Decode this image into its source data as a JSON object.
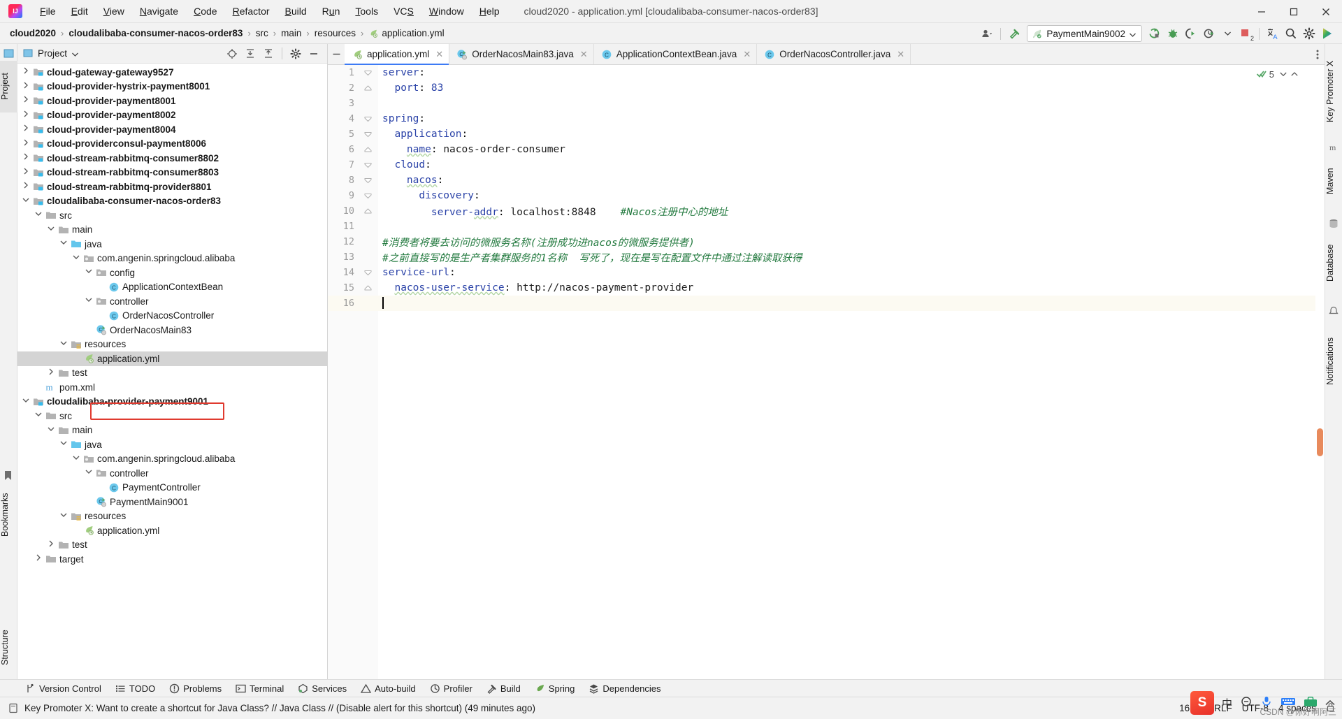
{
  "window": {
    "title": "cloud2020 - application.yml [cloudalibaba-consumer-nacos-order83]",
    "logo_text": "IJ",
    "minimize_label": "Minimize",
    "maximize_label": "Maximize",
    "close_label": "Close"
  },
  "menubar": {
    "items": [
      {
        "label": "File",
        "mnemonic": "F"
      },
      {
        "label": "Edit",
        "mnemonic": "E"
      },
      {
        "label": "View",
        "mnemonic": "V"
      },
      {
        "label": "Navigate",
        "mnemonic": "N"
      },
      {
        "label": "Code",
        "mnemonic": "C"
      },
      {
        "label": "Refactor",
        "mnemonic": "R"
      },
      {
        "label": "Build",
        "mnemonic": "B"
      },
      {
        "label": "Run",
        "mnemonic": "u"
      },
      {
        "label": "Tools",
        "mnemonic": "T"
      },
      {
        "label": "VCS",
        "mnemonic": "S"
      },
      {
        "label": "Window",
        "mnemonic": "W"
      },
      {
        "label": "Help",
        "mnemonic": "H"
      }
    ]
  },
  "breadcrumb": {
    "items": [
      {
        "label": "cloud2020",
        "bold": true,
        "icon": null
      },
      {
        "label": "cloudalibaba-consumer-nacos-order83",
        "bold": true,
        "icon": null
      },
      {
        "label": "src",
        "bold": false,
        "icon": null
      },
      {
        "label": "main",
        "bold": false,
        "icon": null
      },
      {
        "label": "resources",
        "bold": false,
        "icon": null
      },
      {
        "label": "application.yml",
        "bold": false,
        "icon": "yml-leaf-icon"
      }
    ],
    "separator": "›"
  },
  "toolbar": {
    "run_config_label": "PaymentMain9002",
    "run_config_icon": "spring-leaf-icon",
    "icons": [
      {
        "name": "user-dropdown-icon",
        "title": "Account"
      },
      {
        "name": "hammer-icon",
        "title": "Build Project"
      },
      {
        "name": "run-icon",
        "title": "Run"
      },
      {
        "name": "debug-icon",
        "title": "Debug"
      },
      {
        "name": "run-coverage-icon",
        "title": "Run with Coverage"
      },
      {
        "name": "profiler-icon",
        "title": "Profiler"
      },
      {
        "name": "stop-icon",
        "title": "Stop"
      },
      {
        "name": "translate-icon",
        "title": "Translate"
      },
      {
        "name": "search-icon",
        "title": "Search Everywhere"
      },
      {
        "name": "settings-gear-icon",
        "title": "Settings"
      },
      {
        "name": "ide-feature-icon",
        "title": "Feature"
      }
    ],
    "stop_badge": "2"
  },
  "left_strip": {
    "tabs": [
      {
        "label": "Project",
        "selected": true
      },
      {
        "label": "Bookmarks",
        "selected": false
      },
      {
        "label": "Structure",
        "selected": false
      }
    ]
  },
  "right_strip": {
    "tabs": [
      {
        "label": "Key Promoter X"
      },
      {
        "label": "m"
      },
      {
        "label": "Maven"
      },
      {
        "label": "Database"
      },
      {
        "label": "Notifications"
      }
    ]
  },
  "project_panel": {
    "title": "Project",
    "dropdown_icon": "chevron-down-icon",
    "header_icons": [
      {
        "name": "locate-file-icon"
      },
      {
        "name": "expand-all-icon"
      },
      {
        "name": "collapse-all-icon"
      },
      {
        "name": "gear-icon"
      },
      {
        "name": "hide-icon"
      }
    ],
    "tree": [
      {
        "label": "cloud-gateway-gateway9527",
        "depth": 1,
        "arrow": "right",
        "icon": "module-icon",
        "bold": true,
        "selected": false
      },
      {
        "label": "cloud-provider-hystrix-payment8001",
        "depth": 1,
        "arrow": "right",
        "icon": "module-icon",
        "bold": true,
        "selected": false
      },
      {
        "label": "cloud-provider-payment8001",
        "depth": 1,
        "arrow": "right",
        "icon": "module-icon",
        "bold": true,
        "selected": false
      },
      {
        "label": "cloud-provider-payment8002",
        "depth": 1,
        "arrow": "right",
        "icon": "module-icon",
        "bold": true,
        "selected": false
      },
      {
        "label": "cloud-provider-payment8004",
        "depth": 1,
        "arrow": "right",
        "icon": "module-icon",
        "bold": true,
        "selected": false
      },
      {
        "label": "cloud-providerconsul-payment8006",
        "depth": 1,
        "arrow": "right",
        "icon": "module-icon",
        "bold": true,
        "selected": false
      },
      {
        "label": "cloud-stream-rabbitmq-consumer8802",
        "depth": 1,
        "arrow": "right",
        "icon": "module-icon",
        "bold": true,
        "selected": false
      },
      {
        "label": "cloud-stream-rabbitmq-consumer8803",
        "depth": 1,
        "arrow": "right",
        "icon": "module-icon",
        "bold": true,
        "selected": false
      },
      {
        "label": "cloud-stream-rabbitmq-provider8801",
        "depth": 1,
        "arrow": "right",
        "icon": "module-icon",
        "bold": true,
        "selected": false
      },
      {
        "label": "cloudalibaba-consumer-nacos-order83",
        "depth": 1,
        "arrow": "down",
        "icon": "module-icon",
        "bold": true,
        "selected": false
      },
      {
        "label": "src",
        "depth": 2,
        "arrow": "down",
        "icon": "folder-icon",
        "bold": false,
        "selected": false
      },
      {
        "label": "main",
        "depth": 3,
        "arrow": "down",
        "icon": "folder-icon",
        "bold": false,
        "selected": false
      },
      {
        "label": "java",
        "depth": 4,
        "arrow": "down",
        "icon": "source-folder-icon",
        "bold": false,
        "selected": false
      },
      {
        "label": "com.angenin.springcloud.alibaba",
        "depth": 5,
        "arrow": "down",
        "icon": "package-icon",
        "bold": false,
        "selected": false
      },
      {
        "label": "config",
        "depth": 6,
        "arrow": "down",
        "icon": "package-icon",
        "bold": false,
        "selected": false
      },
      {
        "label": "ApplicationContextBean",
        "depth": 7,
        "arrow": "none",
        "icon": "java-class-icon",
        "bold": false,
        "selected": false
      },
      {
        "label": "controller",
        "depth": 6,
        "arrow": "down",
        "icon": "package-icon",
        "bold": false,
        "selected": false
      },
      {
        "label": "OrderNacosController",
        "depth": 7,
        "arrow": "none",
        "icon": "java-class-icon",
        "bold": false,
        "selected": false
      },
      {
        "label": "OrderNacosMain83",
        "depth": 6,
        "arrow": "none",
        "icon": "spring-boot-class-icon",
        "bold": false,
        "selected": false
      },
      {
        "label": "resources",
        "depth": 4,
        "arrow": "down",
        "icon": "resources-folder-icon",
        "bold": false,
        "selected": false
      },
      {
        "label": "application.yml",
        "depth": 5,
        "arrow": "none",
        "icon": "yml-leaf-icon",
        "bold": false,
        "selected": true
      },
      {
        "label": "test",
        "depth": 3,
        "arrow": "right",
        "icon": "folder-icon",
        "bold": false,
        "selected": false
      },
      {
        "label": "pom.xml",
        "depth": 2,
        "arrow": "none",
        "icon": "maven-icon",
        "bold": false,
        "selected": false
      },
      {
        "label": "cloudalibaba-provider-payment9001",
        "depth": 1,
        "arrow": "down",
        "icon": "module-icon",
        "bold": true,
        "selected": false
      },
      {
        "label": "src",
        "depth": 2,
        "arrow": "down",
        "icon": "folder-icon",
        "bold": false,
        "selected": false
      },
      {
        "label": "main",
        "depth": 3,
        "arrow": "down",
        "icon": "folder-icon",
        "bold": false,
        "selected": false
      },
      {
        "label": "java",
        "depth": 4,
        "arrow": "down",
        "icon": "source-folder-icon",
        "bold": false,
        "selected": false
      },
      {
        "label": "com.angenin.springcloud.alibaba",
        "depth": 5,
        "arrow": "down",
        "icon": "package-icon",
        "bold": false,
        "selected": false
      },
      {
        "label": "controller",
        "depth": 6,
        "arrow": "down",
        "icon": "package-icon",
        "bold": false,
        "selected": false
      },
      {
        "label": "PaymentController",
        "depth": 7,
        "arrow": "none",
        "icon": "java-class-icon",
        "bold": false,
        "selected": false
      },
      {
        "label": "PaymentMain9001",
        "depth": 6,
        "arrow": "none",
        "icon": "spring-boot-class-icon",
        "bold": false,
        "selected": false
      },
      {
        "label": "resources",
        "depth": 4,
        "arrow": "down",
        "icon": "resources-folder-icon",
        "bold": false,
        "selected": false
      },
      {
        "label": "application.yml",
        "depth": 5,
        "arrow": "none",
        "icon": "yml-leaf-icon",
        "bold": false,
        "selected": false
      },
      {
        "label": "test",
        "depth": 3,
        "arrow": "right",
        "icon": "folder-icon",
        "bold": false,
        "selected": false
      },
      {
        "label": "target",
        "depth": 2,
        "arrow": "right",
        "icon": "folder-icon",
        "bold": false,
        "selected": false
      }
    ]
  },
  "editor": {
    "tabs": [
      {
        "label": "application.yml",
        "icon": "yml-leaf-icon",
        "active": true,
        "closable": true
      },
      {
        "label": "OrderNacosMain83.java",
        "icon": "spring-boot-class-icon",
        "active": false,
        "closable": true
      },
      {
        "label": "ApplicationContextBean.java",
        "icon": "java-class-icon",
        "active": false,
        "closable": true
      },
      {
        "label": "OrderNacosController.java",
        "icon": "java-class-icon",
        "active": false,
        "closable": true
      }
    ],
    "inspection_count": "5",
    "file_name": "application.yml",
    "lines": [
      {
        "n": "1",
        "fold": "open-top",
        "indent": 0,
        "tokens": [
          {
            "t": "server",
            "c": "k"
          },
          {
            "t": ":",
            "c": "p"
          }
        ]
      },
      {
        "n": "2",
        "fold": "open-end",
        "indent": 1,
        "tokens": [
          {
            "t": "port",
            "c": "k"
          },
          {
            "t": ": ",
            "c": "p"
          },
          {
            "t": "83",
            "c": "num"
          }
        ]
      },
      {
        "n": "3",
        "fold": "none",
        "indent": 0,
        "tokens": []
      },
      {
        "n": "4",
        "fold": "open-top",
        "indent": 0,
        "tokens": [
          {
            "t": "spring",
            "c": "k"
          },
          {
            "t": ":",
            "c": "p"
          }
        ]
      },
      {
        "n": "5",
        "fold": "open-top",
        "indent": 1,
        "tokens": [
          {
            "t": "application",
            "c": "k"
          },
          {
            "t": ":",
            "c": "p"
          }
        ]
      },
      {
        "n": "6",
        "fold": "open-end",
        "indent": 2,
        "tokens": [
          {
            "t": "name",
            "c": "k squig"
          },
          {
            "t": ": ",
            "c": "p"
          },
          {
            "t": "nacos-order-consumer",
            "c": "val"
          }
        ]
      },
      {
        "n": "7",
        "fold": "open-top",
        "indent": 1,
        "tokens": [
          {
            "t": "cloud",
            "c": "k"
          },
          {
            "t": ":",
            "c": "p"
          }
        ]
      },
      {
        "n": "8",
        "fold": "open-top",
        "indent": 2,
        "tokens": [
          {
            "t": "nacos",
            "c": "k squig"
          },
          {
            "t": ":",
            "c": "p"
          }
        ]
      },
      {
        "n": "9",
        "fold": "open-top",
        "indent": 3,
        "tokens": [
          {
            "t": "discovery",
            "c": "k"
          },
          {
            "t": ":",
            "c": "p"
          }
        ]
      },
      {
        "n": "10",
        "fold": "open-end",
        "indent": 4,
        "tokens": [
          {
            "t": "server-",
            "c": "k"
          },
          {
            "t": "addr",
            "c": "k squig"
          },
          {
            "t": ": ",
            "c": "p"
          },
          {
            "t": "localhost:8848",
            "c": "val"
          },
          {
            "t": "    ",
            "c": "p"
          },
          {
            "t": "#Nacos注册中心的地址",
            "c": "cmt"
          }
        ]
      },
      {
        "n": "11",
        "fold": "none",
        "indent": 0,
        "tokens": []
      },
      {
        "n": "12",
        "fold": "none",
        "indent": 0,
        "tokens": [
          {
            "t": "#消费者将要去访问的微服务名称(注册成功进nacos的微服务提供者)",
            "c": "cmt"
          }
        ]
      },
      {
        "n": "13",
        "fold": "none",
        "indent": 0,
        "tokens": [
          {
            "t": "#之前直接写的是生产者集群服务的1名称  写死了，现在是写在配置文件中通过注解读取获得",
            "c": "cmt"
          }
        ]
      },
      {
        "n": "14",
        "fold": "open-top",
        "indent": 0,
        "tokens": [
          {
            "t": "service-url",
            "c": "k"
          },
          {
            "t": ":",
            "c": "p"
          }
        ]
      },
      {
        "n": "15",
        "fold": "open-end",
        "indent": 1,
        "tokens": [
          {
            "t": "nacos-user-service",
            "c": "k squig"
          },
          {
            "t": ": ",
            "c": "p"
          },
          {
            "t": "http://nacos-payment-provider",
            "c": "val"
          }
        ]
      },
      {
        "n": "16",
        "fold": "none",
        "indent": 0,
        "tokens": [],
        "caret": true,
        "current": true
      }
    ]
  },
  "bottom_bar": {
    "items": [
      {
        "label": "Version Control",
        "icon": "branch-icon"
      },
      {
        "label": "TODO",
        "icon": "todo-list-icon"
      },
      {
        "label": "Problems",
        "icon": "problems-icon"
      },
      {
        "label": "Terminal",
        "icon": "terminal-icon"
      },
      {
        "label": "Services",
        "icon": "services-icon"
      },
      {
        "label": "Auto-build",
        "icon": "warning-triangle-icon"
      },
      {
        "label": "Profiler",
        "icon": "profiler-icon"
      },
      {
        "label": "Build",
        "icon": "hammer-icon"
      },
      {
        "label": "Spring",
        "icon": "spring-leaf-icon"
      },
      {
        "label": "Dependencies",
        "icon": "dependencies-icon"
      }
    ]
  },
  "status_bar": {
    "message": "Key Promoter X: Want to create a shortcut for Java Class? // Java Class // (Disable alert for this shortcut) (49 minutes ago)",
    "message_icon": "notification-icon",
    "caret_position": "16:1",
    "line_separator": "CRLF",
    "encoding": "UTF-8",
    "indent": "4 spaces"
  },
  "ime": {
    "logo": "S",
    "lang": "中",
    "icons": [
      "half-width-icon",
      "mic-icon",
      "keyboard-icon",
      "toolbox-icon",
      "chevron-up-icon"
    ]
  },
  "watermark": "CSDN @你好啊阿三",
  "colors": {
    "accent_blue": "#3d7bf5",
    "keyword": "#2b43a8",
    "comment_green": "#237a3f",
    "highlight_red": "#e03a2f",
    "selection_gray": "#d4d4d4",
    "chrome_gray": "#f2f2f2"
  }
}
